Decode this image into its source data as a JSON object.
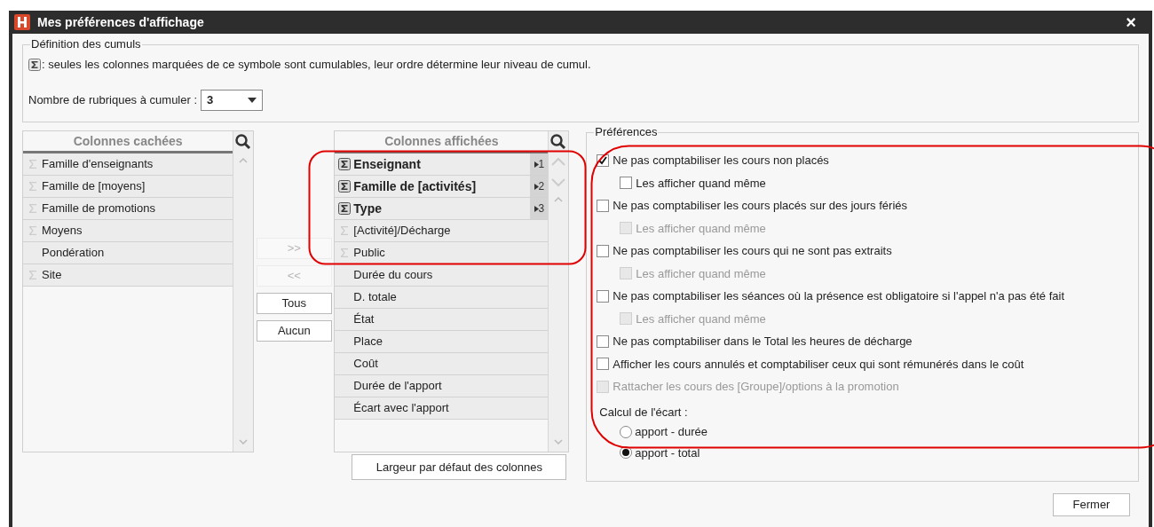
{
  "window": {
    "title": "Mes préférences d'affichage",
    "close": "×"
  },
  "cumul_definition": {
    "title": "Définition des cumuls",
    "note": ": seules les colonnes marquées de ce symbole sont cumulables, leur ordre détermine leur niveau de cumul.",
    "count_label": "Nombre de rubriques à cumuler :",
    "count_value": "3"
  },
  "hidden_columns": {
    "header": "Colonnes cachées",
    "rows": [
      {
        "label": "Famille d'enseignants",
        "kind": "cumulable"
      },
      {
        "label": "Famille de [moyens]",
        "kind": "cumulable"
      },
      {
        "label": "Famille de promotions",
        "kind": "cumulable"
      },
      {
        "label": "Moyens",
        "kind": "cumulable"
      },
      {
        "label": "Pondération",
        "kind": "plain"
      },
      {
        "label": "Site",
        "kind": "cumulable"
      }
    ]
  },
  "transfer_buttons": [
    {
      "label": ">>",
      "disabled": true
    },
    {
      "label": "<<",
      "disabled": true
    },
    {
      "label": "Tous",
      "disabled": false
    },
    {
      "label": "Aucun",
      "disabled": false
    }
  ],
  "displayed_columns": {
    "header": "Colonnes affichées",
    "rows": [
      {
        "label": "Enseignant",
        "kind": "cumulated",
        "rank": "1"
      },
      {
        "label": "Famille de [activités]",
        "kind": "cumulated",
        "rank": "2"
      },
      {
        "label": "Type",
        "kind": "cumulated",
        "rank": "3"
      },
      {
        "label": "[Activité]/Décharge",
        "kind": "cumulable"
      },
      {
        "label": "Public",
        "kind": "cumulable"
      },
      {
        "label": "Durée du cours",
        "kind": "plain"
      },
      {
        "label": "D. totale",
        "kind": "plain"
      },
      {
        "label": "État",
        "kind": "plain"
      },
      {
        "label": "Place",
        "kind": "plain"
      },
      {
        "label": "Coût",
        "kind": "plain"
      },
      {
        "label": "Durée de l'apport",
        "kind": "plain"
      },
      {
        "label": "Écart avec l'apport",
        "kind": "plain"
      }
    ]
  },
  "column_width_button": "Largeur par défaut des colonnes",
  "preferences": {
    "title": "Préférences",
    "options": [
      {
        "label": "Ne pas comptabiliser les cours non placés",
        "checked": true,
        "disabled": false,
        "children": [
          {
            "label": "Les afficher quand même",
            "checked": false,
            "disabled": false
          }
        ]
      },
      {
        "label": "Ne pas comptabiliser les cours placés sur des jours fériés",
        "checked": false,
        "disabled": false,
        "children": [
          {
            "label": "Les afficher quand même",
            "checked": false,
            "disabled": true
          }
        ]
      },
      {
        "label": "Ne pas comptabiliser les cours qui ne sont pas extraits",
        "checked": false,
        "disabled": false,
        "children": [
          {
            "label": "Les afficher quand même",
            "checked": false,
            "disabled": true
          }
        ]
      },
      {
        "label": "Ne pas comptabiliser les séances où la présence est obligatoire si l'appel n'a pas été fait",
        "checked": false,
        "disabled": false,
        "children": [
          {
            "label": "Les afficher quand même",
            "checked": false,
            "disabled": true
          }
        ]
      },
      {
        "label": "Ne pas comptabiliser dans le Total les heures de décharge",
        "checked": false,
        "disabled": false
      },
      {
        "label": "Afficher les cours annulés et comptabiliser ceux qui sont rémunérés dans le coût",
        "checked": false,
        "disabled": false
      },
      {
        "label": "Rattacher les cours des [Groupe]/options à la promotion",
        "checked": false,
        "disabled": true
      }
    ],
    "deviation": {
      "label": "Calcul de l'écart :",
      "options": [
        {
          "label": "apport - durée",
          "selected": false
        },
        {
          "label": "apport - total",
          "selected": true
        }
      ]
    }
  },
  "close_button": "Fermer"
}
